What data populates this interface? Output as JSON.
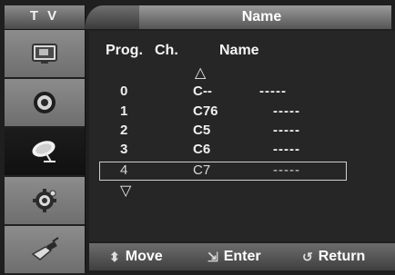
{
  "sidebar": {
    "title": "T V",
    "items": [
      {
        "icon": "picture-icon"
      },
      {
        "icon": "sound-icon"
      },
      {
        "icon": "channel-dish-icon"
      },
      {
        "icon": "setup-gear-icon"
      },
      {
        "icon": "input-plug-icon"
      }
    ]
  },
  "header": {
    "title": "Name"
  },
  "table": {
    "headers": {
      "prog": "Prog.",
      "ch": "Ch.",
      "name": "Name"
    },
    "scroll_up": "△",
    "scroll_down": "▽",
    "rows": [
      {
        "prog": "0",
        "ch": "C--",
        "name": "-----"
      },
      {
        "prog": "1",
        "ch": "C76",
        "name": "-----"
      },
      {
        "prog": "2",
        "ch": "C5",
        "name": "-----"
      },
      {
        "prog": "3",
        "ch": "C6",
        "name": "-----"
      },
      {
        "prog": "4",
        "ch": "C7",
        "name": "-----"
      }
    ]
  },
  "footer": {
    "move": "Move",
    "enter": "Enter",
    "return": "Return"
  }
}
